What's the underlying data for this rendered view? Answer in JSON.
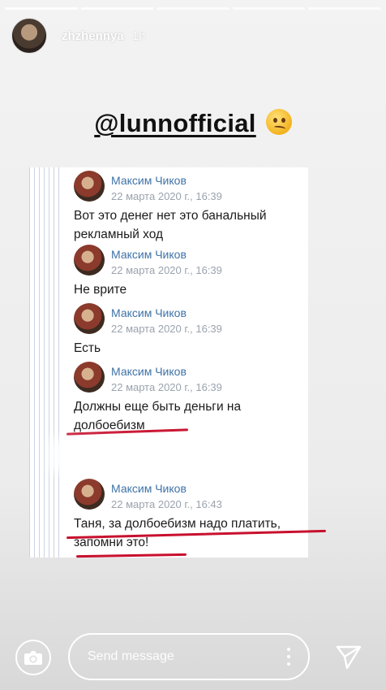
{
  "story": {
    "username": "zhzhennya",
    "time": "1h",
    "progress": [
      1,
      1,
      0,
      0,
      0
    ]
  },
  "sticker": {
    "mention": "@lunnofficial"
  },
  "messages": [
    {
      "name": "Максим Чиков",
      "date": "22 марта 2020 г., 16:39",
      "lines": [
        "Вот это денег нет это банальный",
        "рекламный ход"
      ]
    },
    {
      "name": "Максим Чиков",
      "date": "22 марта 2020 г., 16:39",
      "lines": [
        "Не врите"
      ]
    },
    {
      "name": "Максим Чиков",
      "date": "22 марта 2020 г., 16:39",
      "lines": [
        "Есть"
      ]
    },
    {
      "name": "Максим Чиков",
      "date": "22 марта 2020 г., 16:39",
      "lines": [
        "Должны еще быть деньги на",
        "долбоебизм"
      ]
    },
    {
      "name": "Максим Чиков",
      "date": "22 марта 2020 г., 16:43",
      "lines": [
        "Таня, за долбоебизм надо платить,",
        "запомни это!"
      ]
    }
  ],
  "composer": {
    "placeholder": "Send message"
  },
  "icons": {
    "camera": "camera-icon",
    "more": "more-vertical-icon",
    "send": "send-icon",
    "emoji": "woozy-face-icon"
  },
  "colors": {
    "annotation": "#c8102e",
    "author": "#3f72a8"
  }
}
